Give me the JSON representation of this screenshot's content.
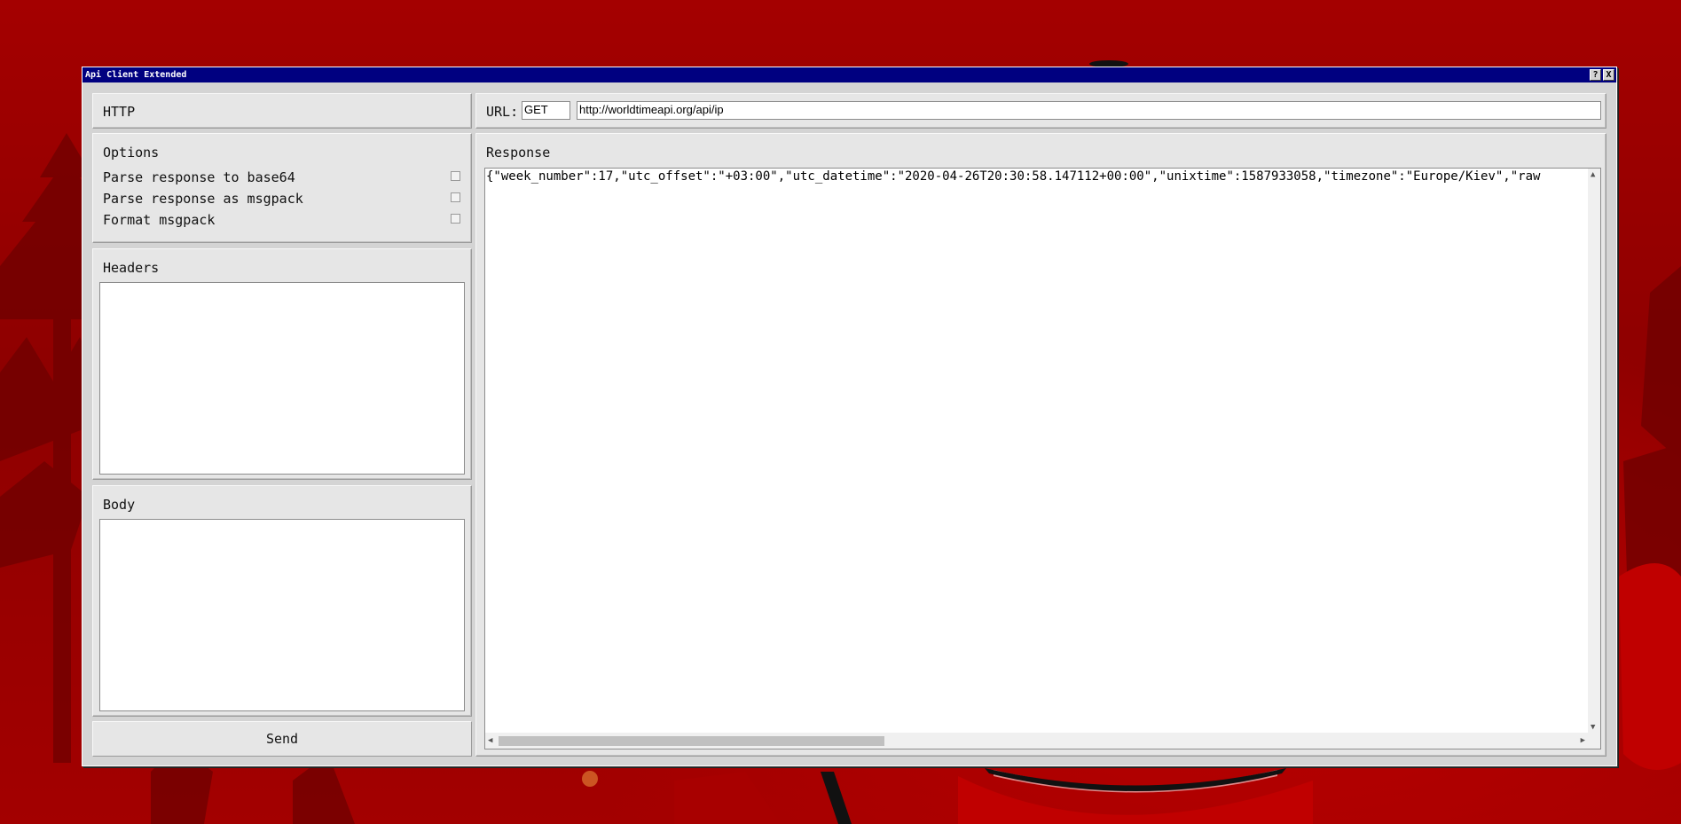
{
  "window": {
    "title": "Api Client Extended",
    "help_button": "?",
    "close_button": "X"
  },
  "http_panel": {
    "title": "HTTP"
  },
  "options": {
    "title": "Options",
    "items": [
      {
        "label": "Parse response to base64",
        "checked": false
      },
      {
        "label": "Parse response as msgpack",
        "checked": false
      },
      {
        "label": "Format msgpack",
        "checked": false
      }
    ]
  },
  "headers": {
    "title": "Headers",
    "value": ""
  },
  "body": {
    "title": "Body",
    "value": ""
  },
  "send": {
    "label": "Send"
  },
  "request": {
    "url_label": "URL:",
    "method": "GET",
    "url": "http://worldtimeapi.org/api/ip"
  },
  "response": {
    "title": "Response",
    "text": "{\"week_number\":17,\"utc_offset\":\"+03:00\",\"utc_datetime\":\"2020-04-26T20:30:58.147112+00:00\",\"unixtime\":1587933058,\"timezone\":\"Europe/Kiev\",\"raw"
  },
  "colors": {
    "titlebar": "#000080",
    "window_bg": "#d4d4d4",
    "panel_bg": "#e6e6e6",
    "desktop": "#a00000"
  }
}
